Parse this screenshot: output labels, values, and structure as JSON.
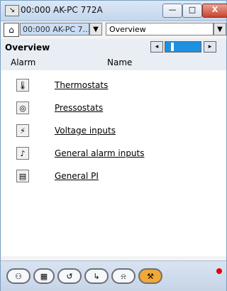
{
  "window": {
    "title": "00:000 AK-PC 772A",
    "min_label": "—",
    "max_label": "□",
    "close_label": "X"
  },
  "toolbar": {
    "device_value": "00:000 AK-PC 7...",
    "view_value": "Overview"
  },
  "header": {
    "title": "Overview",
    "columns": [
      "Alarm",
      "Name"
    ]
  },
  "items": [
    {
      "icon": "thermostat-icon",
      "label": "Thermostats"
    },
    {
      "icon": "pressure-gauge-icon",
      "label": "Pressostats"
    },
    {
      "icon": "voltage-input-icon",
      "label": "Voltage inputs"
    },
    {
      "icon": "alarm-bell-icon",
      "label": "General alarm inputs"
    },
    {
      "icon": "controller-icon",
      "label": "General PI"
    }
  ],
  "bottom_tabs": [
    {
      "name": "overview-tab",
      "active": false
    },
    {
      "name": "schedule-tab",
      "active": false
    },
    {
      "name": "history-tab",
      "active": false
    },
    {
      "name": "graph-tab",
      "active": false
    },
    {
      "name": "alarms-tab",
      "active": false
    },
    {
      "name": "tools-tab",
      "active": true
    }
  ],
  "colors": {
    "accent": "#1e90e0",
    "active_tab": "#f0a836",
    "alarm_indicator": "#e10000"
  }
}
